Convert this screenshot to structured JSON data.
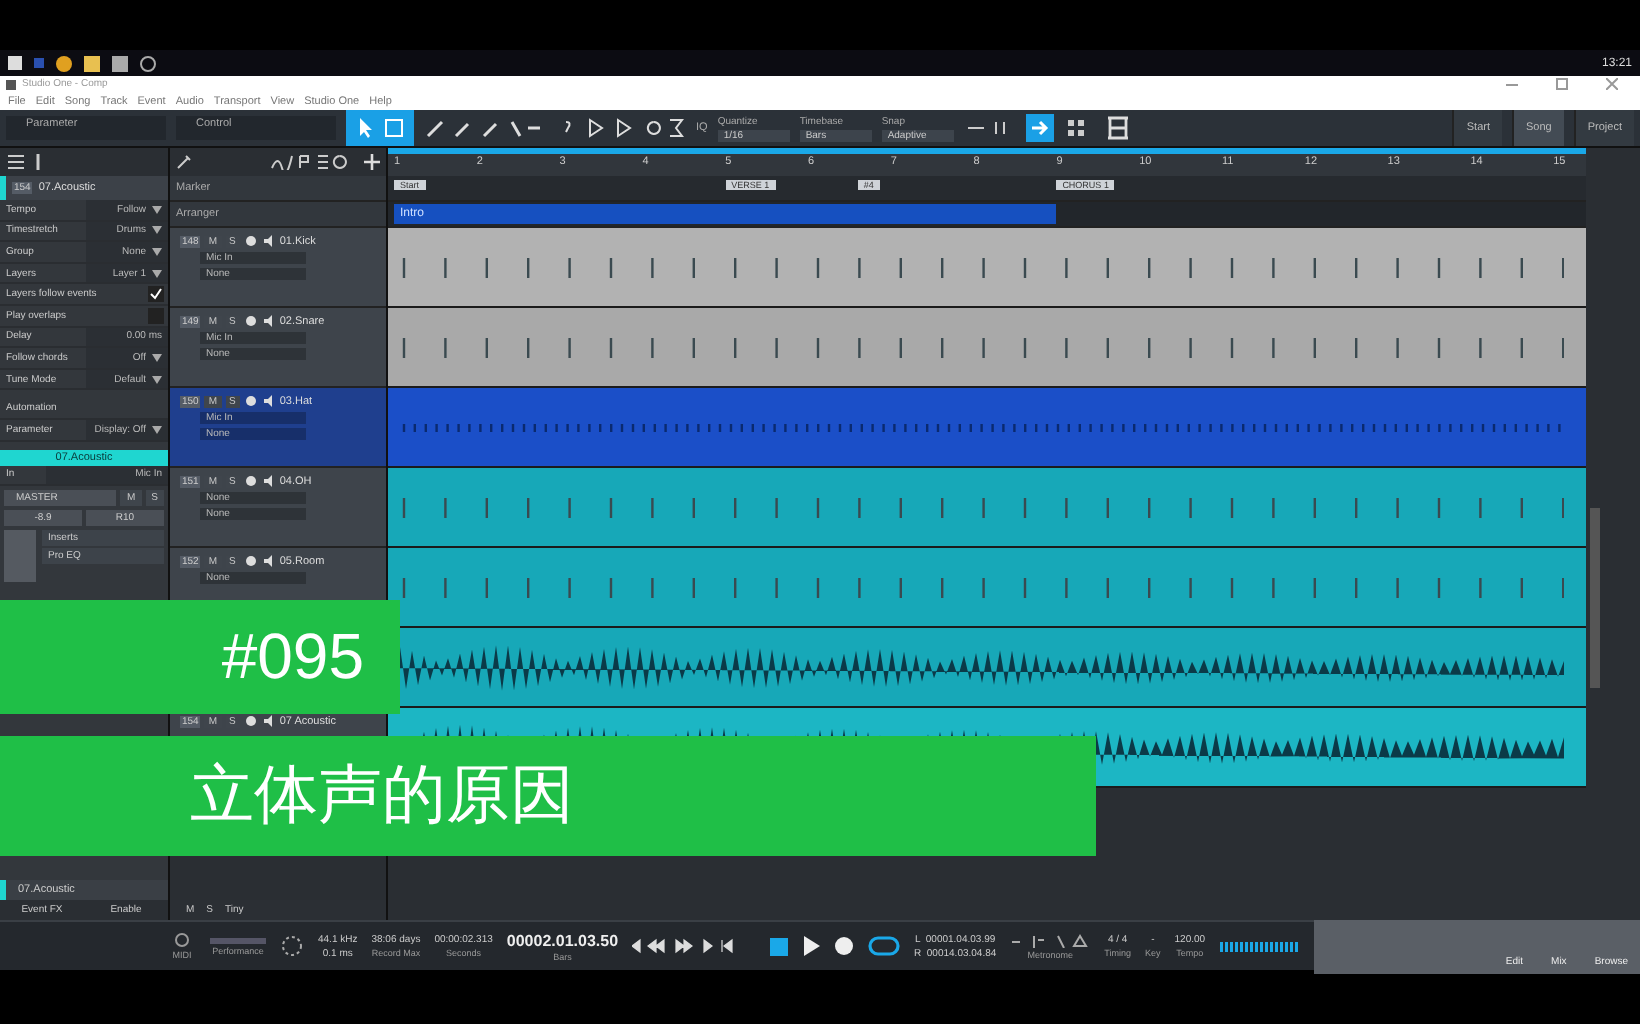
{
  "taskbar": {
    "clock": "13:21"
  },
  "window": {
    "title": "Studio One - Comp"
  },
  "menu": [
    "File",
    "Edit",
    "Song",
    "Track",
    "Event",
    "Audio",
    "Transport",
    "View",
    "Studio One",
    "Help"
  ],
  "toolbar": {
    "parameter": "Parameter",
    "control": "Control",
    "iq": "IQ",
    "quantize": {
      "label": "Quantize",
      "value": "1/16"
    },
    "timebase": {
      "label": "Timebase",
      "value": "Bars"
    },
    "snap": {
      "label": "Snap",
      "value": "Adaptive"
    },
    "pages": [
      {
        "label": "Start",
        "selected": false
      },
      {
        "label": "Song",
        "selected": true
      },
      {
        "label": "Project",
        "selected": false
      }
    ]
  },
  "inspector": {
    "track": {
      "number": "154",
      "name": "07.Acoustic",
      "color": "#1fd6d0"
    },
    "rows": [
      {
        "kind": "select",
        "label": "Tempo",
        "value": "Follow"
      },
      {
        "kind": "select",
        "label": "Timestretch",
        "value": "Drums"
      },
      {
        "kind": "select",
        "label": "Group",
        "value": "None"
      },
      {
        "kind": "select",
        "label": "Layers",
        "value": "Layer 1"
      },
      {
        "kind": "check",
        "label": "Layers follow events",
        "checked": true
      },
      {
        "kind": "check",
        "label": "Play overlaps",
        "checked": false
      },
      {
        "kind": "value",
        "label": "Delay",
        "value": "0.00 ms"
      },
      {
        "kind": "select",
        "label": "Follow chords",
        "value": "Off"
      },
      {
        "kind": "select",
        "label": "Tune Mode",
        "value": "Default"
      }
    ],
    "automation": "Automation",
    "parameter": "Parameter",
    "display": "Display: Off",
    "channel": {
      "name": "07.Acoustic",
      "in_label": "In",
      "input": "Mic In",
      "output": "MASTER",
      "mute": "M",
      "solo": "S",
      "volume": "-8.9",
      "pan": "R10",
      "inserts": "Inserts",
      "plugin": "Pro EQ"
    },
    "footer": {
      "name": "07.Acoustic",
      "event_fx": "Event FX",
      "enable": "Enable"
    }
  },
  "tracklist": {
    "marker": "Marker",
    "arranger": "Arranger",
    "footer": [
      "M",
      "S",
      "Tiny"
    ]
  },
  "ruler": [
    "1",
    "2",
    "3",
    "4",
    "5",
    "6",
    "7",
    "8",
    "9",
    "10",
    "11",
    "12",
    "13",
    "14",
    "15"
  ],
  "markers": [
    "Start",
    "VERSE 1",
    "#4",
    "CHORUS 1"
  ],
  "arranger": [
    "Intro"
  ],
  "tracks": [
    {
      "number": "148",
      "name": "01.Kick",
      "mute": "M",
      "solo": "S",
      "input": "Mic In",
      "output": "None",
      "color": "#b2b2b2",
      "selected": false,
      "kind": "hits"
    },
    {
      "number": "149",
      "name": "02.Snare",
      "mute": "M",
      "solo": "S",
      "input": "Mic In",
      "output": "None",
      "color": "#a9a9a9",
      "selected": false,
      "kind": "hits"
    },
    {
      "number": "150",
      "name": "03.Hat",
      "mute": "M",
      "solo": "S",
      "input": "Mic In",
      "output": "None",
      "color": "#1b4fc8",
      "selected": true,
      "kind": "dense"
    },
    {
      "number": "151",
      "name": "04.OH",
      "mute": "M",
      "solo": "S",
      "input": "None",
      "output": "None",
      "color": "#17a8b8",
      "selected": false,
      "kind": "hits"
    },
    {
      "number": "152",
      "name": "05.Room",
      "mute": "M",
      "solo": "S",
      "input": "None",
      "color": "#17a8b8",
      "selected": false,
      "kind": "hits"
    },
    {
      "color": "#17a8b8",
      "kind": "sustain"
    },
    {
      "number": "154",
      "name": "07 Acoustic",
      "mute": "M",
      "solo": "S",
      "color": "#1cb6c4",
      "selected": false,
      "kind": "sustain"
    }
  ],
  "transport": {
    "midi": "MIDI",
    "performance": "Performance",
    "rate": "44.1 kHz",
    "latency": "0.1 ms",
    "record_max": "38:06 days",
    "record_max_label": "Record Max",
    "seconds": "00:00:02.313",
    "seconds_label": "Seconds",
    "bars": "00002.01.03.50",
    "bars_label": "Bars",
    "left": "L  00001.04.03.99",
    "right": "R  00014.03.04.84",
    "metronome": "Metronome",
    "timing": "4 / 4",
    "timing_label": "Timing",
    "key": "-",
    "key_label": "Key",
    "tempo": "120.00",
    "tempo_label": "Tempo",
    "views": [
      {
        "label": "Edit",
        "selected": false
      },
      {
        "label": "Mix",
        "selected": false
      },
      {
        "label": "Browse",
        "selected": false
      }
    ]
  },
  "overlay": {
    "episode": "#095",
    "title": "立体声的原因"
  }
}
